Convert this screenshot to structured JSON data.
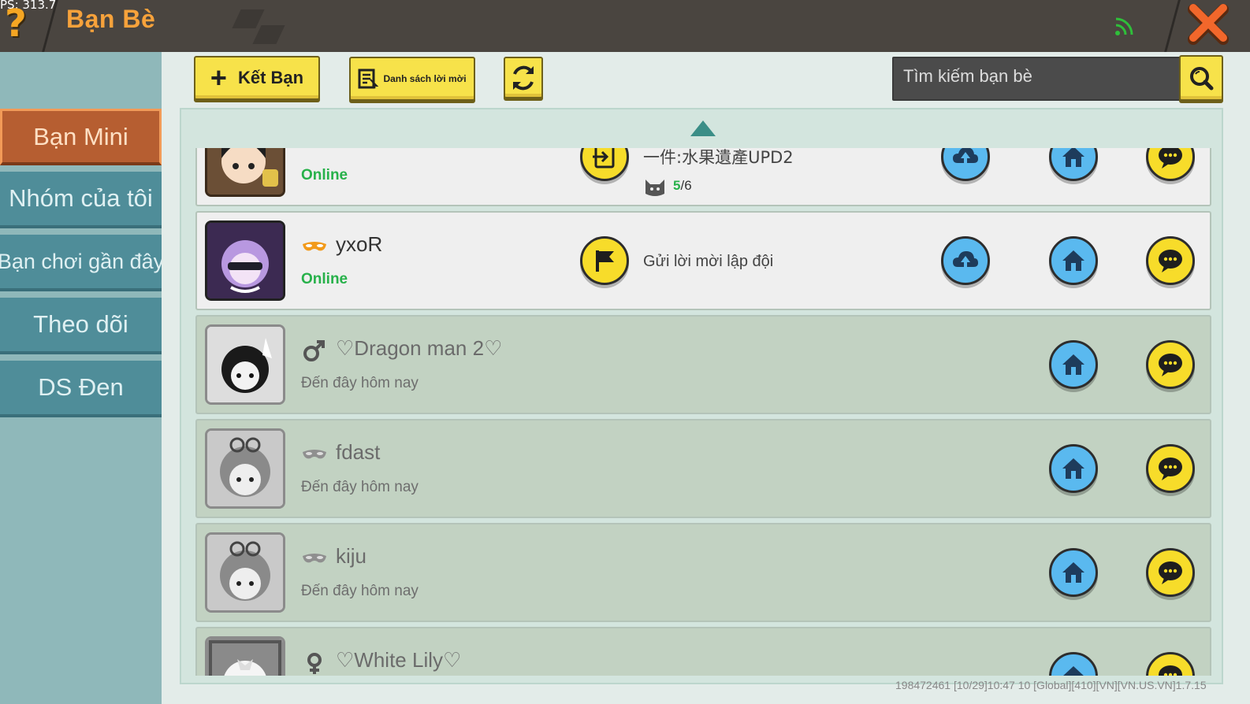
{
  "topbar": {
    "fps": "PS: 313.7",
    "title": "Bạn Bè",
    "help_icon": "question-mark-icon",
    "close_icon": "close-x-icon",
    "signal_icon": "signal-icon"
  },
  "sidebar": {
    "items": [
      {
        "label": "Bạn Mini",
        "active": true
      },
      {
        "label": "Nhóm của tôi",
        "active": false
      },
      {
        "label": "Bạn chơi gần đây",
        "active": false
      },
      {
        "label": "Theo dõi",
        "active": false
      },
      {
        "label": "DS Đen",
        "active": false
      }
    ]
  },
  "toolbar": {
    "add_friend_label": "Kết Bạn",
    "invites_label": "Danh sách lời mời",
    "search_placeholder": "Tìm kiếm bạn bè"
  },
  "friends": [
    {
      "name": "",
      "status": "Online",
      "room": "一件:水果遺產UPD2",
      "players": "5",
      "max_players": "/6"
    },
    {
      "name": "yxoR",
      "status": "Online",
      "action_text": "Gửi lời mời lập đội"
    },
    {
      "name": "♡Dragon man 2♡",
      "status": "Đến đây hôm nay"
    },
    {
      "name": "fdast",
      "status": "Đến đây hôm nay"
    },
    {
      "name": "kiju",
      "status": "Đến đây hôm nay"
    },
    {
      "name": "♡White Lily♡",
      "status": ""
    }
  ],
  "footer": {
    "info": "198472461   [10/29]10:47 10   [Global][410][VN][VN.US.VN]1.7.15"
  },
  "colors": {
    "accent_orange": "#f7a23b",
    "button_yellow": "#f7e24a",
    "online_green": "#27b14a",
    "circle_blue": "#5ab9ef"
  }
}
